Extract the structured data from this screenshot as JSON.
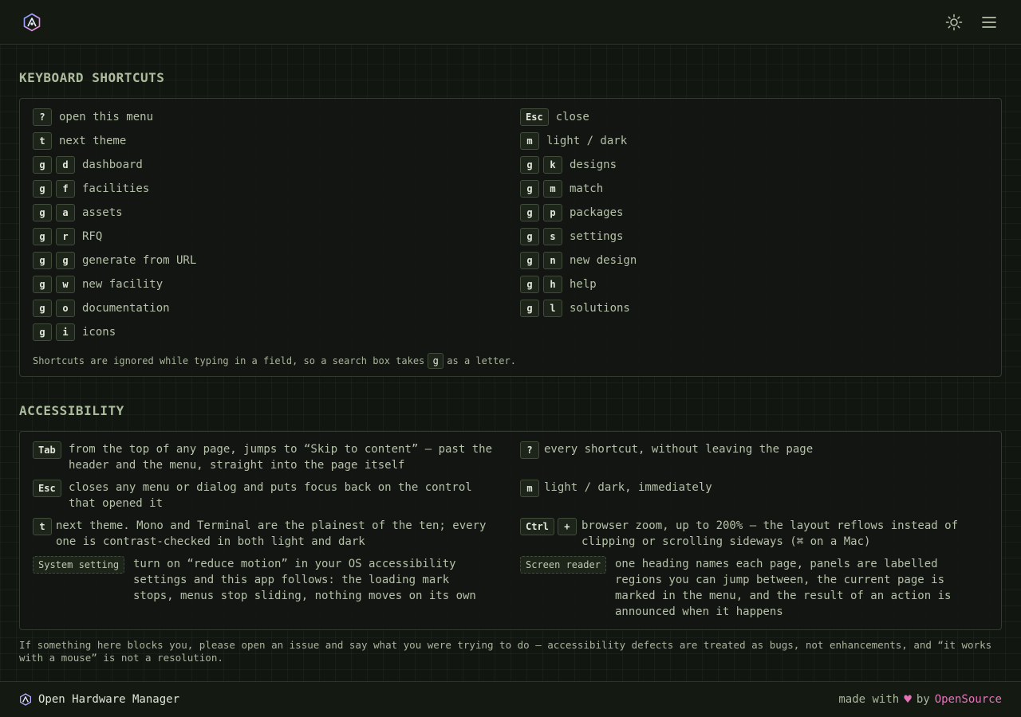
{
  "header": {
    "logo_icon": "hexagon-logo-icon",
    "theme_icon": "sun-icon",
    "menu_icon": "hamburger-menu-icon"
  },
  "shortcuts": {
    "title": "KEYBOARD SHORTCUTS",
    "left": [
      {
        "keys": [
          "?"
        ],
        "label": "open this menu"
      },
      {
        "keys": [
          "t"
        ],
        "label": "next theme"
      },
      {
        "keys": [
          "g",
          "d"
        ],
        "label": "dashboard"
      },
      {
        "keys": [
          "g",
          "f"
        ],
        "label": "facilities"
      },
      {
        "keys": [
          "g",
          "a"
        ],
        "label": "assets"
      },
      {
        "keys": [
          "g",
          "r"
        ],
        "label": "RFQ"
      },
      {
        "keys": [
          "g",
          "g"
        ],
        "label": "generate from URL"
      },
      {
        "keys": [
          "g",
          "w"
        ],
        "label": "new facility"
      },
      {
        "keys": [
          "g",
          "o"
        ],
        "label": "documentation"
      },
      {
        "keys": [
          "g",
          "i"
        ],
        "label": "icons"
      }
    ],
    "right": [
      {
        "keys": [
          "Esc"
        ],
        "label": "close"
      },
      {
        "keys": [
          "m"
        ],
        "label": "light / dark"
      },
      {
        "keys": [
          "g",
          "k"
        ],
        "label": "designs"
      },
      {
        "keys": [
          "g",
          "m"
        ],
        "label": "match"
      },
      {
        "keys": [
          "g",
          "p"
        ],
        "label": "packages"
      },
      {
        "keys": [
          "g",
          "s"
        ],
        "label": "settings"
      },
      {
        "keys": [
          "g",
          "n"
        ],
        "label": "new design"
      },
      {
        "keys": [
          "g",
          "h"
        ],
        "label": "help"
      },
      {
        "keys": [
          "g",
          "l"
        ],
        "label": "solutions"
      }
    ],
    "note_before": "Shortcuts are ignored while typing in a field, so a search box takes",
    "note_key": "g",
    "note_after": "as a letter."
  },
  "accessibility": {
    "title": "ACCESSIBILITY",
    "items": {
      "tab": {
        "keys": [
          "Tab"
        ],
        "desc": "from the top of any page, jumps to “Skip to content” — past the header and the menu, straight into the page itself"
      },
      "help": {
        "keys": [
          "?"
        ],
        "desc": "every shortcut, without leaving the page"
      },
      "esc": {
        "keys": [
          "Esc"
        ],
        "desc": "closes any menu or dialog and puts focus back on the control that opened it"
      },
      "mode": {
        "keys": [
          "m"
        ],
        "desc": "light / dark, immediately"
      },
      "theme": {
        "keys": [
          "t"
        ],
        "desc": "next theme. Mono and Terminal are the plainest of the ten; every one is contrast-checked in both light and dark"
      },
      "zoom": {
        "keys": [
          "Ctrl",
          "+"
        ],
        "desc": "browser zoom, up to 200% — the layout reflows instead of clipping or scrolling sideways (⌘ on a Mac)"
      },
      "motion": {
        "keys": [
          "System setting"
        ],
        "desc": "turn on “reduce motion” in your OS accessibility settings and this app follows: the loading mark stops, menus stop sliding, nothing moves on its own"
      },
      "reader": {
        "keys": [
          "Screen reader"
        ],
        "desc": "one heading names each page, panels are labelled regions you can jump between, the current page is marked in the menu, and the result of an action is announced when it happens"
      }
    },
    "footnote": "If something here blocks you, please open an issue and say what you were trying to do — accessibility defects are treated as bugs, not enhancements, and “it works with a mouse” is not a resolution."
  },
  "footer": {
    "app_name": "Open Hardware Manager",
    "made_with": "made with",
    "heart": "♥",
    "by": "by",
    "link": "OpenSource",
    "heart_color": "#e472b7"
  }
}
